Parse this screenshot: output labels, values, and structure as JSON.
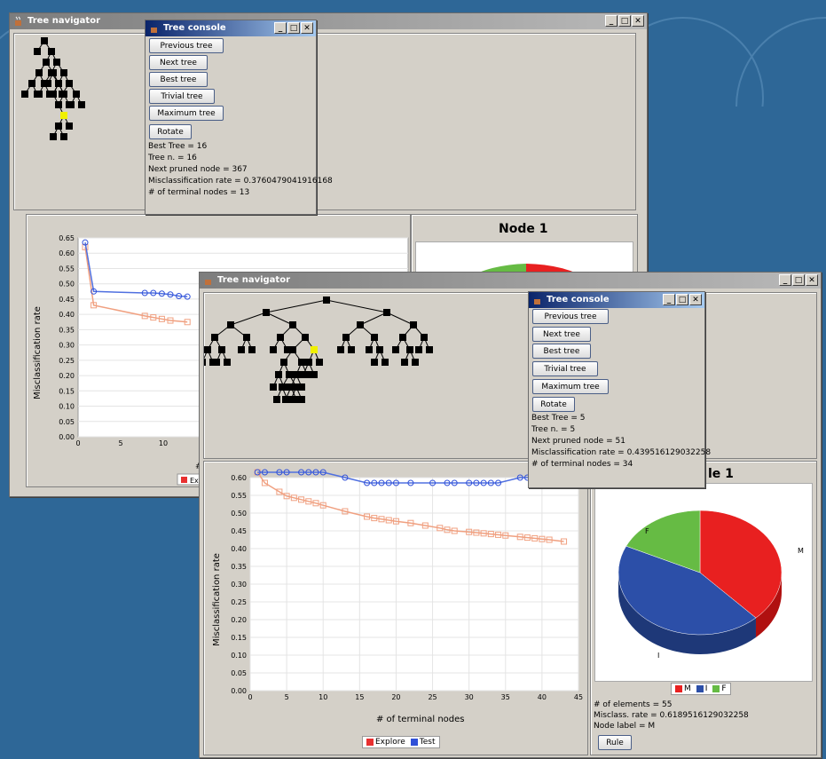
{
  "colors": {
    "explore": "#e83030",
    "test": "#3050d8",
    "explore_line": "#f0a080",
    "test_line": "#5070e0",
    "pie_M": "#e82020",
    "pie_I": "#2c4fa8",
    "pie_F": "#66bb44"
  },
  "back": {
    "navigator": {
      "title": "Tree navigator"
    },
    "console": {
      "title": "Tree console",
      "buttons": [
        "Previous tree",
        "Next tree",
        "Best tree",
        "Trivial tree",
        "Maximum tree",
        "Rotate"
      ],
      "info": [
        "Best Tree = 16",
        "Tree n. = 16",
        "Next pruned node = 367",
        "Misclassification rate = 0.3760479041916168",
        "# of terminal nodes = 13"
      ]
    },
    "chart": {
      "ylabel": "Misclassification rate",
      "yticks": [
        "0.65",
        "0.60",
        "0.55",
        "0.50",
        "0.45",
        "0.40",
        "0.35",
        "0.30",
        "0.25",
        "0.20",
        "0.15",
        "0.10",
        "0.05",
        "0.00"
      ],
      "xticks": [
        "0",
        "5",
        "10"
      ],
      "xlabel_partial": "#",
      "legend_partial": "Ex"
    },
    "pie": {
      "title": "Node 1"
    }
  },
  "front": {
    "navigator": {
      "title": "Tree navigator"
    },
    "console": {
      "title": "Tree console",
      "buttons": [
        "Previous tree",
        "Next tree",
        "Best tree",
        "Trivial tree",
        "Maximum tree",
        "Rotate"
      ],
      "info": [
        "Best Tree = 5",
        "Tree n. = 5",
        "Next pruned node = 51",
        "Misclassification rate = 0.439516129032258",
        "# of terminal nodes = 34"
      ]
    },
    "pie_title_partial": "le 1",
    "pie": {
      "labels": {
        "M": "M",
        "I": "I",
        "F": "F"
      },
      "legend": [
        "M",
        "I",
        "F"
      ],
      "info": [
        "# of elements = 55",
        "Misclass. rate = 0.6189516129032258",
        "Node label = M"
      ],
      "rule_button": "Rule"
    }
  },
  "chart_data": [
    {
      "type": "line",
      "title": "",
      "xlabel": "# of terminal nodes",
      "ylabel": "Misclassification rate",
      "xlim": [
        0,
        45
      ],
      "ylim": [
        0,
        0.6
      ],
      "xticks": [
        0,
        5,
        10,
        15,
        20,
        25,
        30,
        35,
        40,
        45
      ],
      "yticks": [
        "0.00",
        "0.05",
        "0.10",
        "0.15",
        "0.20",
        "0.25",
        "0.30",
        "0.35",
        "0.40",
        "0.45",
        "0.50",
        "0.55",
        "0.60"
      ],
      "series": [
        {
          "name": "Explore",
          "x": [
            1,
            2,
            4,
            5,
            6,
            7,
            8,
            9,
            10,
            13,
            16,
            17,
            18,
            19,
            20,
            22,
            24,
            26,
            27,
            28,
            30,
            31,
            32,
            33,
            34,
            35,
            37,
            38,
            39,
            40,
            41,
            43
          ],
          "values": [
            0.615,
            0.585,
            0.56,
            0.548,
            0.543,
            0.538,
            0.533,
            0.528,
            0.522,
            0.505,
            0.49,
            0.486,
            0.483,
            0.48,
            0.477,
            0.472,
            0.465,
            0.458,
            0.453,
            0.45,
            0.447,
            0.445,
            0.443,
            0.441,
            0.439,
            0.437,
            0.433,
            0.431,
            0.429,
            0.427,
            0.425,
            0.42
          ]
        },
        {
          "name": "Test",
          "x": [
            1,
            2,
            4,
            5,
            7,
            8,
            9,
            10,
            13,
            16,
            17,
            18,
            19,
            20,
            22,
            25,
            27,
            28,
            30,
            31,
            32,
            33,
            34,
            37,
            38,
            39,
            40,
            43
          ],
          "values": [
            0.615,
            0.615,
            0.615,
            0.615,
            0.615,
            0.615,
            0.615,
            0.615,
            0.6,
            0.585,
            0.585,
            0.585,
            0.585,
            0.585,
            0.585,
            0.585,
            0.585,
            0.585,
            0.585,
            0.585,
            0.585,
            0.585,
            0.585,
            0.6,
            0.6,
            0.6,
            0.6,
            0.6
          ]
        }
      ],
      "legend": [
        "Explore",
        "Test"
      ]
    },
    {
      "type": "pie",
      "title": "Node 1",
      "categories": [
        "M",
        "I",
        "F"
      ],
      "values": [
        0.38,
        0.44,
        0.18
      ],
      "legend": [
        "M",
        "I",
        "F"
      ]
    }
  ]
}
